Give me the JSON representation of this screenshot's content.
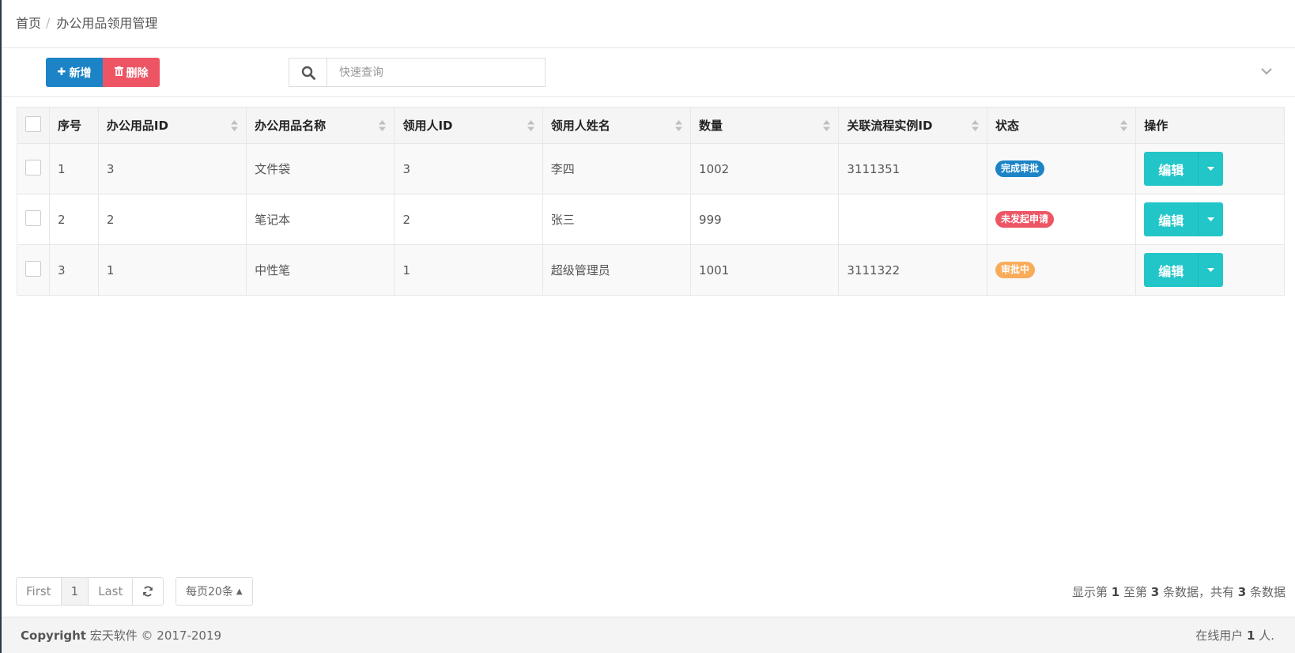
{
  "breadcrumb": {
    "home": "首页",
    "separator": "/",
    "current": "办公用品领用管理"
  },
  "toolbar": {
    "add_label": "新增",
    "delete_label": "删除",
    "search_placeholder": "快速查询",
    "add_icon": "plus-icon",
    "delete_icon": "trash-icon",
    "search_icon": "search-icon",
    "collapse_icon": "chevron-down-icon"
  },
  "table": {
    "columns": [
      "序号",
      "办公用品ID",
      "办公用品名称",
      "领用人ID",
      "领用人姓名",
      "数量",
      "关联流程实例ID",
      "状态",
      "操作"
    ],
    "rows": [
      {
        "seq": "1",
        "item_id": "3",
        "item_name": "文件袋",
        "user_id": "3",
        "user_name": "李四",
        "quantity": "1002",
        "process_id": "3111351",
        "status": "完成审批",
        "status_color": "#1c84c6",
        "action": "编辑"
      },
      {
        "seq": "2",
        "item_id": "2",
        "item_name": "笔记本",
        "user_id": "2",
        "user_name": "张三",
        "quantity": "999",
        "process_id": "",
        "status": "未发起申请",
        "status_color": "#ed5565",
        "action": "编辑"
      },
      {
        "seq": "3",
        "item_id": "1",
        "item_name": "中性笔",
        "user_id": "1",
        "user_name": "超级管理员",
        "quantity": "1001",
        "process_id": "3111322",
        "status": "审批中",
        "status_color": "#f8ac59",
        "action": "编辑"
      }
    ]
  },
  "pagination": {
    "first": "First",
    "current": "1",
    "last": "Last",
    "refresh_icon": "refresh-icon",
    "per_page": "每页20条",
    "info_prefix": "显示第",
    "from": "1",
    "info_mid": "至第",
    "to": "3",
    "info_mid2": "条数据，共有",
    "total": "3",
    "info_suffix": "条数据"
  },
  "footer": {
    "copyright_label": "Copyright",
    "copyright_text": "宏天软件 © 2017-2019",
    "online_prefix": "在线用户",
    "online_count": "1",
    "online_suffix": "人."
  },
  "colors": {
    "primary": "#1c84c6",
    "danger": "#ed5565",
    "warning": "#f8ac59",
    "info": "#23c6c8"
  }
}
